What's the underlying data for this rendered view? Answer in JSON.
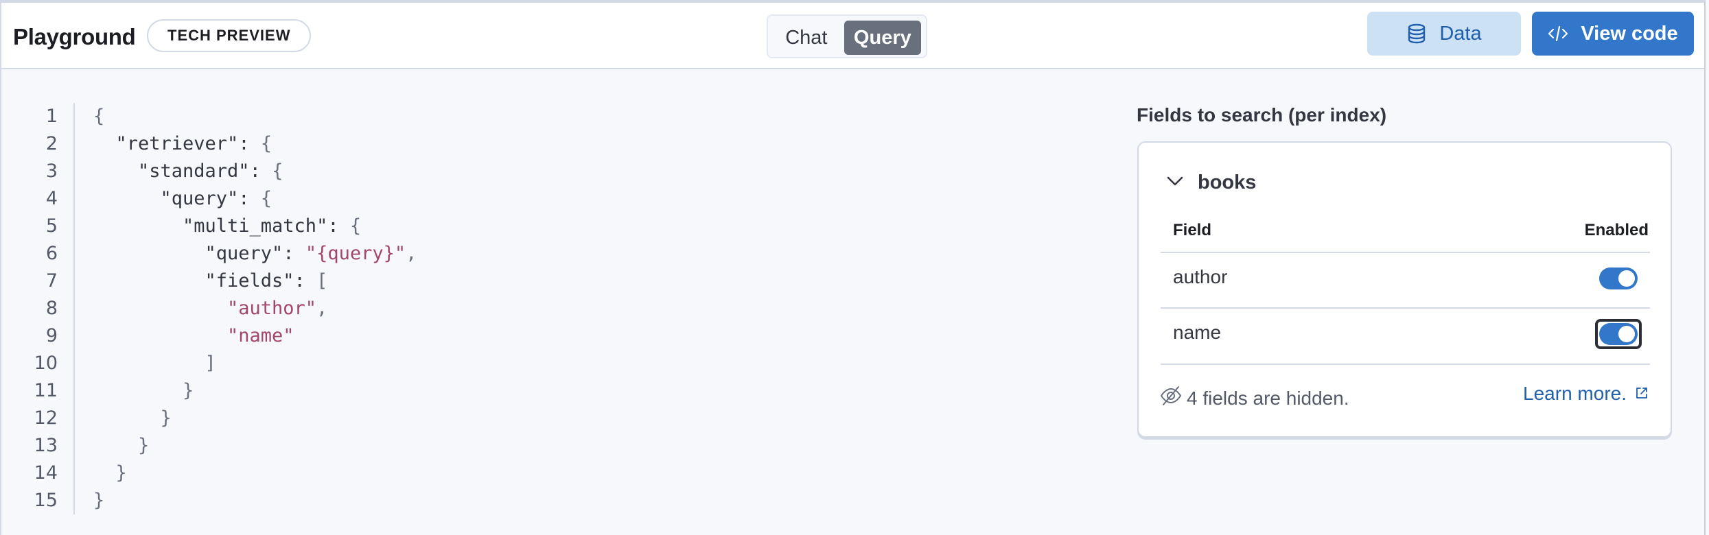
{
  "header": {
    "title": "Playground",
    "badge": "TECH PREVIEW",
    "mode_tabs": [
      {
        "label": "Chat",
        "selected": false
      },
      {
        "label": "Query",
        "selected": true
      }
    ],
    "data_button": {
      "label": "Data",
      "icon": "database-icon"
    },
    "view_code_button": {
      "label": "View code",
      "icon": "code-icon"
    }
  },
  "editor": {
    "lines": [
      {
        "n": "1",
        "indent": 0,
        "tokens": [
          {
            "t": "p",
            "v": "{"
          }
        ]
      },
      {
        "n": "2",
        "indent": 1,
        "tokens": [
          {
            "t": "k",
            "v": "\"retriever\""
          },
          {
            "t": "k",
            "v": ": "
          },
          {
            "t": "p",
            "v": "{"
          }
        ]
      },
      {
        "n": "3",
        "indent": 2,
        "tokens": [
          {
            "t": "k",
            "v": "\"standard\""
          },
          {
            "t": "k",
            "v": ": "
          },
          {
            "t": "p",
            "v": "{"
          }
        ]
      },
      {
        "n": "4",
        "indent": 3,
        "tokens": [
          {
            "t": "k",
            "v": "\"query\""
          },
          {
            "t": "k",
            "v": ": "
          },
          {
            "t": "p",
            "v": "{"
          }
        ]
      },
      {
        "n": "5",
        "indent": 4,
        "tokens": [
          {
            "t": "k",
            "v": "\"multi_match\""
          },
          {
            "t": "k",
            "v": ": "
          },
          {
            "t": "p",
            "v": "{"
          }
        ]
      },
      {
        "n": "6",
        "indent": 5,
        "tokens": [
          {
            "t": "k",
            "v": "\"query\""
          },
          {
            "t": "k",
            "v": ": "
          },
          {
            "t": "s",
            "v": "\"{query}\""
          },
          {
            "t": "p",
            "v": ","
          }
        ]
      },
      {
        "n": "7",
        "indent": 5,
        "tokens": [
          {
            "t": "k",
            "v": "\"fields\""
          },
          {
            "t": "k",
            "v": ": "
          },
          {
            "t": "p",
            "v": "["
          }
        ]
      },
      {
        "n": "8",
        "indent": 6,
        "tokens": [
          {
            "t": "s",
            "v": "\"author\""
          },
          {
            "t": "p",
            "v": ","
          }
        ]
      },
      {
        "n": "9",
        "indent": 6,
        "tokens": [
          {
            "t": "s",
            "v": "\"name\""
          }
        ]
      },
      {
        "n": "10",
        "indent": 5,
        "tokens": [
          {
            "t": "p",
            "v": "]"
          }
        ]
      },
      {
        "n": "11",
        "indent": 4,
        "tokens": [
          {
            "t": "p",
            "v": "}"
          }
        ]
      },
      {
        "n": "12",
        "indent": 3,
        "tokens": [
          {
            "t": "p",
            "v": "}"
          }
        ]
      },
      {
        "n": "13",
        "indent": 2,
        "tokens": [
          {
            "t": "p",
            "v": "}"
          }
        ]
      },
      {
        "n": "14",
        "indent": 1,
        "tokens": [
          {
            "t": "p",
            "v": "}"
          }
        ]
      },
      {
        "n": "15",
        "indent": 0,
        "tokens": [
          {
            "t": "p",
            "v": "}"
          }
        ]
      }
    ]
  },
  "fields_panel": {
    "title": "Fields to search (per index)",
    "index": {
      "name": "books",
      "expanded": true,
      "columns": {
        "field": "Field",
        "enabled": "Enabled"
      },
      "rows": [
        {
          "field": "author",
          "enabled": true,
          "focused": false
        },
        {
          "field": "name",
          "enabled": true,
          "focused": true
        }
      ],
      "hidden_info": "4 fields are hidden.",
      "learn_more": "Learn more."
    }
  },
  "colors": {
    "primary": "#3277c9",
    "primary_light": "#cce1f3",
    "link": "#1f5fab",
    "string_value": "#a2476b",
    "selected_tab": "#69707d"
  }
}
